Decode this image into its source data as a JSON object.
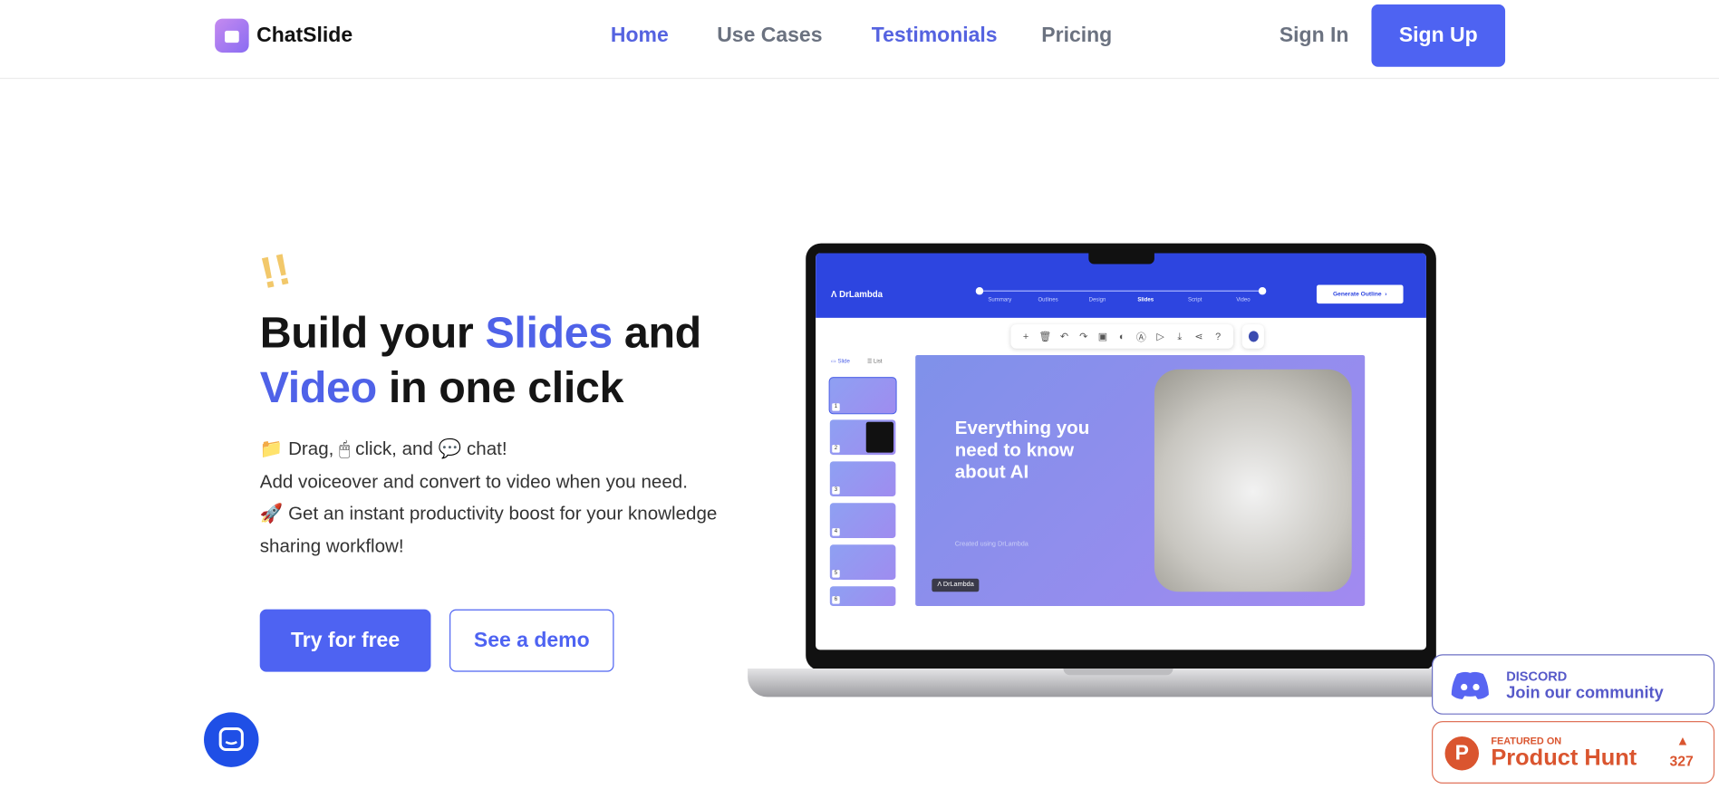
{
  "nav": {
    "brand": "ChatSlide",
    "links": [
      "Home",
      "Use Cases",
      "Testimonials",
      "Pricing"
    ],
    "sign_in": "Sign In",
    "sign_up": "Sign Up"
  },
  "hero": {
    "line1_a": "Build your ",
    "line1_b": "Slides",
    "line1_c": " and",
    "line2_a": "Video",
    "line2_b": " in one click",
    "p1_a": "Drag,",
    "p1_b": "click, and",
    "p1_c": "chat!",
    "p2": "Add voiceover and convert to video when you need.",
    "p3": "Get an instant productivity boost for your knowledge",
    "p4": "sharing workflow!",
    "try": "Try for free",
    "demo": "See a demo",
    "accent": "#4f62e8"
  },
  "app": {
    "brand": "DrLambda",
    "steps": [
      "Summary",
      "Outlines",
      "Design",
      "Slides",
      "Script",
      "Video"
    ],
    "current_step": "Slides",
    "generate": "Generate Outline",
    "tab_slide": "Slide",
    "tab_list": "List",
    "thumbs": [
      "1",
      "2",
      "3",
      "4",
      "5",
      "6"
    ],
    "slide_title": "Everything you need to know about AI",
    "slide_caption": "Created using DrLambda",
    "slide_badge": "DrLambda"
  },
  "discord": {
    "title": "DISCORD",
    "subtitle": "Join our community",
    "color": "#5865f2"
  },
  "producthunt": {
    "featured": "FEATURED ON",
    "name": "Product Hunt",
    "votes": "327",
    "color": "#da552f"
  }
}
